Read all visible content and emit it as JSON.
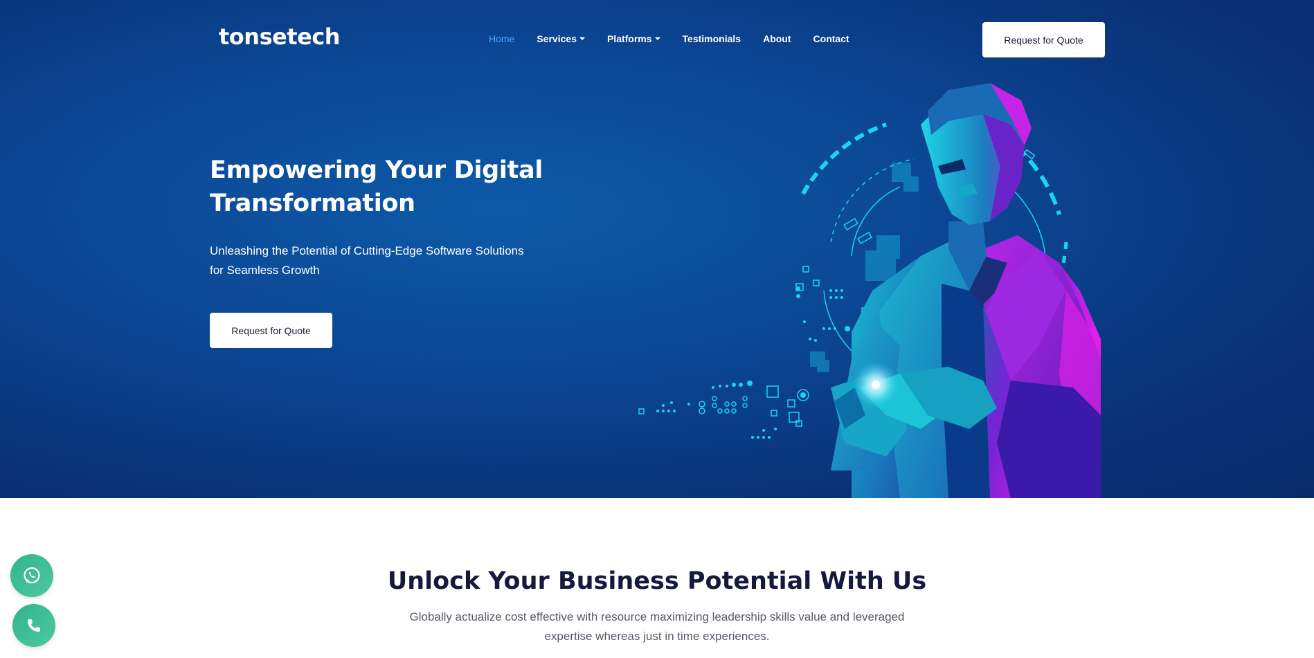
{
  "brand": {
    "name": "tonsetech"
  },
  "nav": {
    "items": [
      {
        "label": "Home",
        "active": true,
        "dropdown": false
      },
      {
        "label": "Services",
        "active": false,
        "dropdown": true
      },
      {
        "label": "Platforms",
        "active": false,
        "dropdown": true
      },
      {
        "label": "Testimonials",
        "active": false,
        "dropdown": false
      },
      {
        "label": "About",
        "active": false,
        "dropdown": false
      },
      {
        "label": "Contact",
        "active": false,
        "dropdown": false
      }
    ],
    "cta_label": "Request for Quote"
  },
  "hero": {
    "title": "Empowering Your Digital Transformation",
    "subtitle": "Unleashing the Potential of Cutting-Edge Software Solutions for Seamless Growth",
    "cta_label": "Request for Quote",
    "illustration_icon": "man-with-phone-illustration"
  },
  "section": {
    "title": "Unlock Your Business Potential With Us",
    "subtitle": "Globally actualize cost effective with resource maximizing leadership skills value and leveraged expertise whereas just in time experiences."
  },
  "floating": {
    "whatsapp_icon": "whatsapp-icon",
    "phone_icon": "phone-icon"
  },
  "colors": {
    "hero_bg": "#0b4693",
    "active_nav": "#4aa8ff",
    "heading_dark": "#15193d",
    "float_green": "#2fb58e",
    "accent_cyan": "#19d6f0",
    "accent_magenta": "#e020e8"
  }
}
